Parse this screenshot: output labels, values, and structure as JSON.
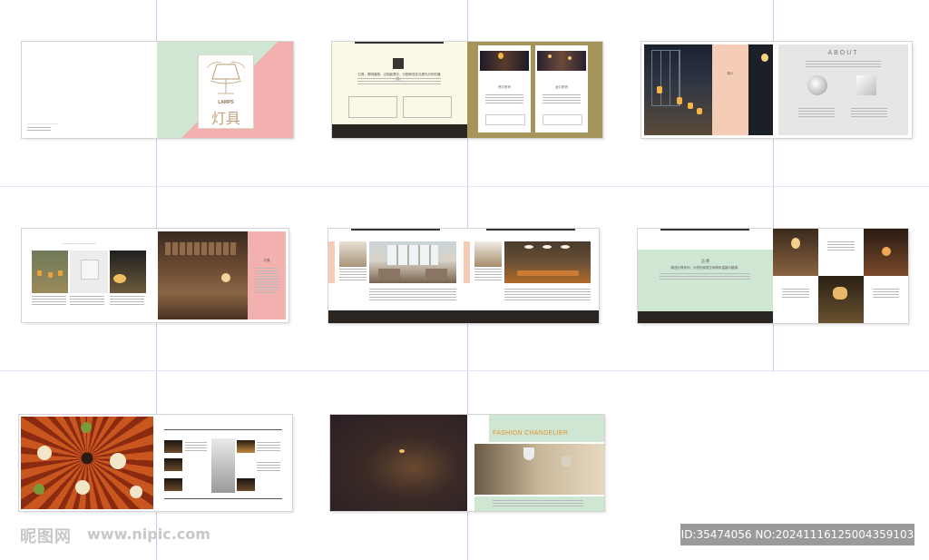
{
  "spread1": {
    "logo_en": "LAMPS",
    "logo_cn": "灯具",
    "footer_text": "———— ———————"
  },
  "spread2": {
    "intro": "灯具，照明器具，泛指能透光、分配和改变光源光分布的器具。",
    "card_left_title": "吊灯系列",
    "card_right_title": "台灯系列"
  },
  "spread3": {
    "about_title": "ABOUT",
    "panel_label": "简介"
  },
  "spread4": {
    "header": "———— ————————",
    "pink_title": "灯具"
  },
  "spread6": {
    "green_title": "品 牌",
    "green_text": "精选灯具系列，为您的家居空间带来温馨与格调。"
  },
  "spread8": {
    "fashion_title": "FASHION CHANDELIER"
  },
  "watermark": {
    "site_cn": "昵图网",
    "site_url": "www.nipic.com",
    "id_text": "ID:35474056 NO:20241116125004359103"
  },
  "colors": {
    "mint": "#cfe6d2",
    "pink": "#f2b0ae",
    "cream": "#fbf8e6",
    "dark": "#2b2522",
    "olive": "#a6955a",
    "accent_orange": "#e5902e"
  }
}
